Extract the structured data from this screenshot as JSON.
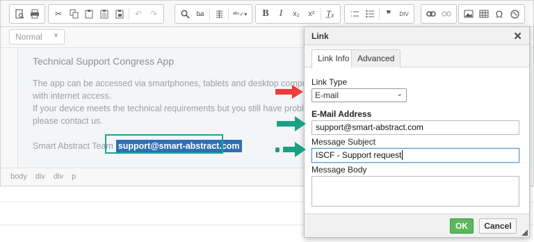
{
  "colors": {
    "accent_teal": "#18a595",
    "arrow_red": "#ef3b3b",
    "arrow_green": "#1aa087",
    "link_highlight": "#2f6fb5",
    "ok_green": "#5cb85c"
  },
  "toolbar": {
    "icons": [
      "source-icon",
      "print-icon",
      "cut-icon",
      "copy-icon",
      "paste-icon",
      "paste-text-icon",
      "paste-word-icon",
      "undo-icon",
      "redo-icon",
      "find-icon",
      "replace-icon",
      "select-all-icon",
      "spellcheck-icon",
      "bold-icon",
      "italic-icon",
      "subscript-icon",
      "superscript-icon",
      "remove-format-icon",
      "numbered-list-icon",
      "bulleted-list-icon",
      "blockquote-icon",
      "div-icon",
      "link-icon",
      "unlink-icon",
      "image-icon",
      "table-icon",
      "special-char-icon",
      "iframe-icon"
    ],
    "bold_label": "B",
    "italic_label": "I",
    "format_value": "Normal"
  },
  "content": {
    "title": "Technical Support Congress App",
    "line1": "The app can be accessed via smartphones, tablets and desktop computers",
    "line2": "with internet access.",
    "line3": "If your device meets the technical requirements but you still have problems,",
    "line4": "please contact us.",
    "signature": "Smart Abstract Team",
    "email_link": "support@smart-abstract.com"
  },
  "statusbar": {
    "path": [
      "body",
      "div",
      "div",
      "p"
    ]
  },
  "dialog": {
    "title": "Link",
    "close_label": "✕",
    "tabs": [
      {
        "label": "Link Info",
        "active": true
      },
      {
        "label": "Advanced",
        "active": false
      }
    ],
    "link_type_label": "Link Type",
    "link_type_value": "E-mail",
    "email_label": "E-Mail Address",
    "email_value": "support@smart-abstract.com",
    "subject_label": "Message Subject",
    "subject_value": "ISCF - Support request",
    "body_label": "Message Body",
    "body_value": "",
    "ok_label": "OK",
    "cancel_label": "Cancel"
  }
}
